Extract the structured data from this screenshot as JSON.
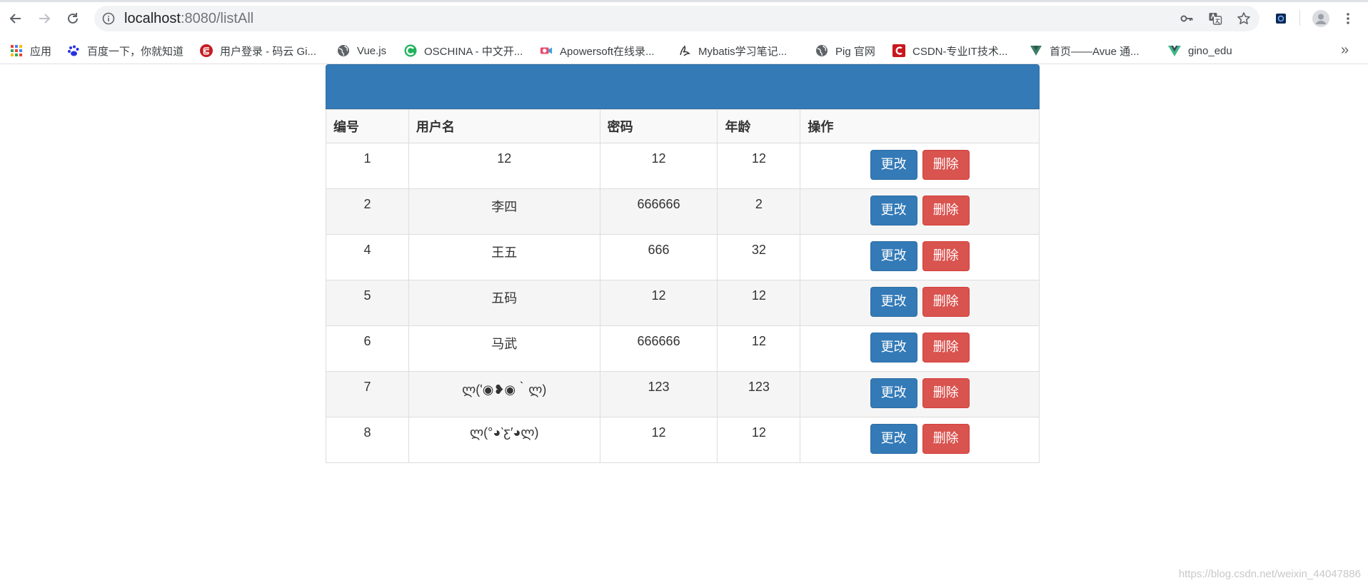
{
  "browser": {
    "url_host": "localhost",
    "url_rest": ":8080/listAll"
  },
  "bookmarks": [
    {
      "label": "应用",
      "icon": "apps-grid-icon"
    },
    {
      "label": "百度一下，你就知道",
      "icon": "baidu-paw-icon"
    },
    {
      "label": "用户登录 - 码云 Gi...",
      "icon": "gitee-icon"
    },
    {
      "label": "Vue.js",
      "icon": "globe-icon"
    },
    {
      "label": "OSCHINA - 中文开...",
      "icon": "oschina-icon"
    },
    {
      "label": "Apowersoft在线录...",
      "icon": "camera-icon"
    },
    {
      "label": "Mybatis学习笔记...",
      "icon": "mybatis-bird-icon"
    },
    {
      "label": "Pig 官网",
      "icon": "globe-icon"
    },
    {
      "label": "CSDN-专业IT技术...",
      "icon": "csdn-icon"
    },
    {
      "label": "首页——Avue 通...",
      "icon": "avue-icon"
    },
    {
      "label": "gino_edu",
      "icon": "vue-logo-icon"
    }
  ],
  "table": {
    "headers": [
      "编号",
      "用户名",
      "密码",
      "年龄",
      "操作"
    ],
    "rows": [
      {
        "id": "1",
        "username": "12",
        "password": "12",
        "age": "12"
      },
      {
        "id": "2",
        "username": "李四",
        "password": "666666",
        "age": "2"
      },
      {
        "id": "4",
        "username": "王五",
        "password": "666",
        "age": "32"
      },
      {
        "id": "5",
        "username": "五码",
        "password": "12",
        "age": "12"
      },
      {
        "id": "6",
        "username": "马武",
        "password": "666666",
        "age": "12"
      },
      {
        "id": "7",
        "username": "ლ('◉❥◉｀ლ)",
        "password": "123",
        "age": "123"
      },
      {
        "id": "8",
        "username": "ლ(°◕‵ƹ′◕ლ)",
        "password": "12",
        "age": "12"
      }
    ],
    "edit_label": "更改",
    "delete_label": "删除"
  },
  "watermark": "https://blog.csdn.net/weixin_44047886",
  "colors": {
    "primary": "#337ab7",
    "danger": "#d9534f"
  }
}
